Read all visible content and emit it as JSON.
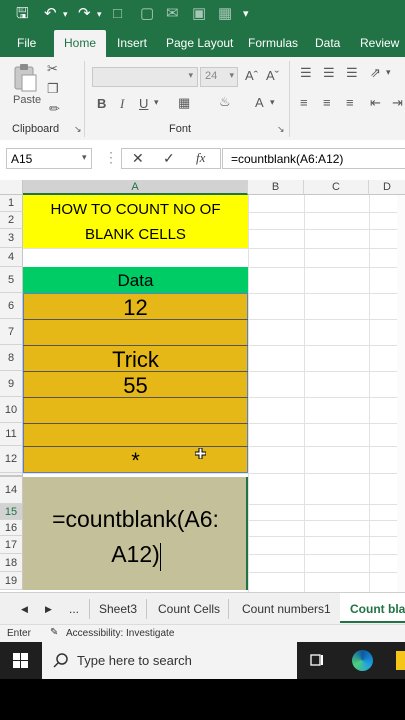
{
  "ribbon_tabs": [
    "File",
    "Home",
    "Insert",
    "Page Layout",
    "Formulas",
    "Data",
    "Review"
  ],
  "active_tab": "Home",
  "ribbon": {
    "paste_label": "Paste",
    "clipboard_label": "Clipboard",
    "font_label": "Font",
    "font_size": "24"
  },
  "formula_bar": {
    "name_box": "A15",
    "formula": "=countblank(A6:A12)"
  },
  "columns": [
    "A",
    "B",
    "C",
    "D"
  ],
  "rows": [
    "1",
    "2",
    "3",
    "4",
    "5",
    "6",
    "7",
    "8",
    "9",
    "10",
    "11",
    "12",
    "14",
    "15",
    "16",
    "17",
    "18",
    "19"
  ],
  "cells": {
    "title_line1": "HOW TO COUNT NO OF",
    "title_line2": "BLANK CELLS",
    "header": "Data",
    "a6": "12",
    "a8": "Trick",
    "a9": "55",
    "a12": "*",
    "formula_line1": "=countblank(A6:",
    "formula_line2": "A12)"
  },
  "sheet_tabs": [
    "...",
    "Sheet3",
    "Count Cells",
    "Count numbers1",
    "Count blan"
  ],
  "active_sheet": "Count blan",
  "status": {
    "mode": "Enter",
    "accessibility": "Accessibility: Investigate"
  },
  "taskbar": {
    "search_placeholder": "Type here to search"
  },
  "colors": {
    "excel_green": "#217346",
    "title_yellow": "#ffff00",
    "header_green": "#00cc66",
    "data_gold": "#e6b817",
    "formula_khaki": "#c4c09a"
  }
}
